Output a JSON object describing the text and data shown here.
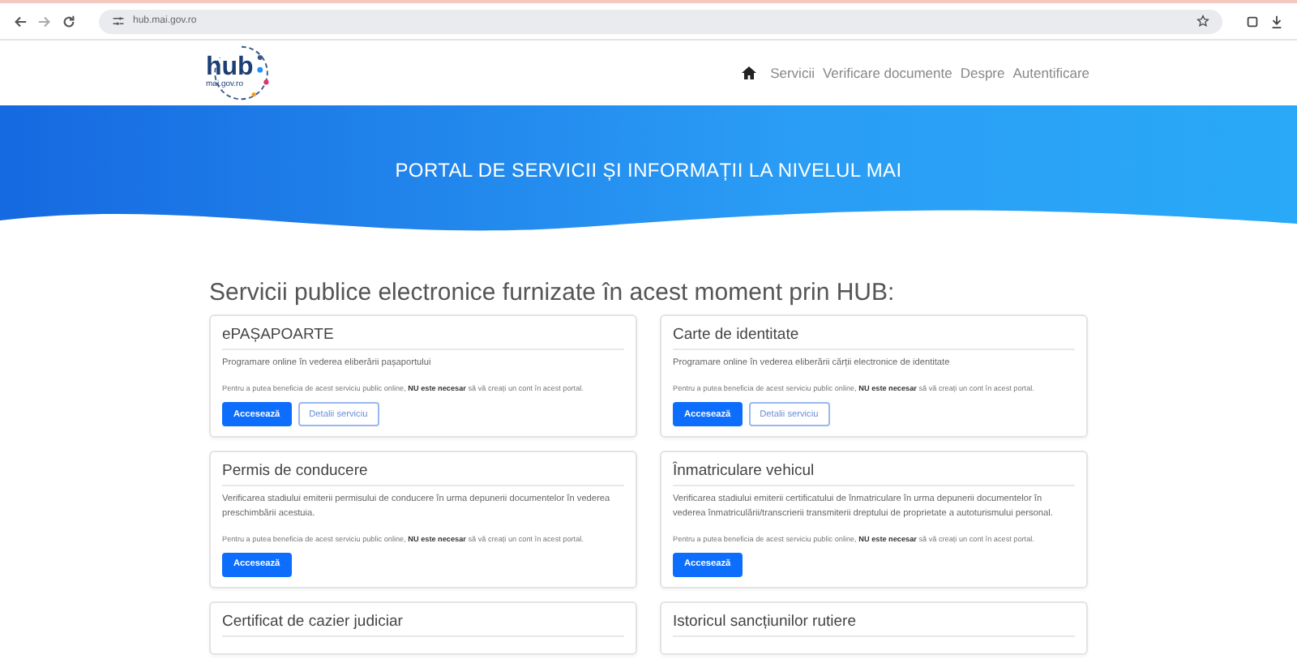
{
  "browser": {
    "url": "hub.mai.gov.ro"
  },
  "header": {
    "logo_text": "hub",
    "logo_sub": "mai.gov.ro",
    "nav": [
      {
        "label": "Servicii"
      },
      {
        "label": "Verificare documente"
      },
      {
        "label": "Despre"
      },
      {
        "label": "Autentificare"
      }
    ]
  },
  "hero": {
    "title": "PORTAL DE SERVICII ȘI INFORMAȚII LA NIVELUL MAI"
  },
  "section": {
    "heading": "Servicii publice electronice furnizate în acest moment prin  HUB:"
  },
  "cards": [
    {
      "title": "ePAȘAPOARTE",
      "description": "Programare online în vederea eliberării pașaportului",
      "note": "Pentru a putea beneficia de acest serviciu public online, **NU este necesar** să vă creați un cont în acest portal.",
      "buttons": [
        {
          "label": "Accesează",
          "kind": "primary"
        },
        {
          "label": "Detalii serviciu",
          "kind": "outline"
        }
      ]
    },
    {
      "title": "Carte de identitate",
      "description": "Programare online în vederea eliberării cărții electronice de identitate",
      "note": "Pentru a putea beneficia de acest serviciu public online, **NU este necesar** să vă creați un cont în acest portal.",
      "buttons": [
        {
          "label": "Accesează",
          "kind": "primary"
        },
        {
          "label": "Detalii serviciu",
          "kind": "outline"
        }
      ]
    },
    {
      "title": "Permis de conducere",
      "description": "Verificarea stadiului emiterii permisului de conducere în urma depunerii documentelor în vederea preschimbării acestuia.",
      "note": "Pentru a putea beneficia de acest serviciu public online, **NU este necesar** să vă creați un cont în acest portal.",
      "buttons": [
        {
          "label": "Accesează",
          "kind": "primary"
        }
      ]
    },
    {
      "title": "Înmatriculare vehicul",
      "description": "Verificarea stadiului emiterii certificatului de înmatriculare în urma depunerii documentelor în vederea înmatriculării/transcrierii transmiterii dreptului de proprietate a autoturismului personal.",
      "note": "Pentru a putea beneficia de acest serviciu public online, **NU este necesar** să vă creați un cont în acest portal.",
      "buttons": [
        {
          "label": "Accesează",
          "kind": "primary"
        }
      ]
    },
    {
      "title": "Certificat de cazier judiciar"
    },
    {
      "title": "Istoricul sancțiunilor rutiere"
    }
  ]
}
